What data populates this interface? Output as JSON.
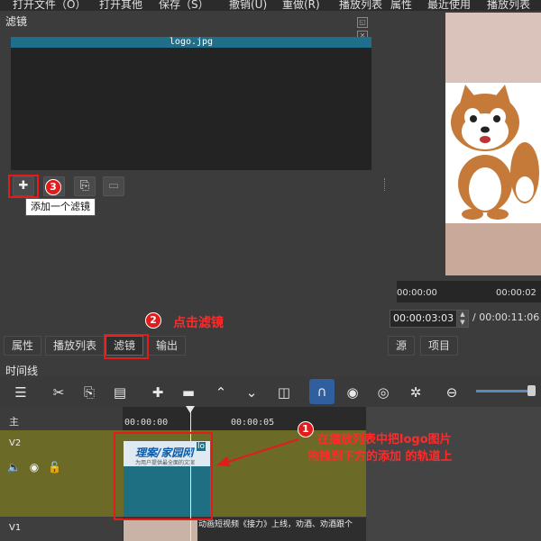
{
  "menu": {
    "items": [
      "打开文件（O）",
      "打开其他",
      "保存（S）",
      "撤销(U)",
      "重做(R)",
      "播放列表",
      "属性",
      "最近使用",
      "播放列表"
    ]
  },
  "filter_panel": {
    "title": "滤镜",
    "list_header": "logo.jpg",
    "tooltip": "添加一个滤镜"
  },
  "preview": {
    "ruler_left": "00:00:00",
    "ruler_right": "00:00:02",
    "timecode": "00:00:03:03",
    "duration": "/ 00:00:11:06"
  },
  "tabs": {
    "left": [
      "属性",
      "播放列表",
      "滤镜",
      "输出"
    ],
    "right": [
      "源",
      "项目"
    ],
    "selected": "滤镜"
  },
  "timeline": {
    "title": "时间线",
    "master_label": "主",
    "ruler_ticks": [
      "00:00:00",
      "00:00:05"
    ],
    "v2_label": "V2",
    "v1_label": "V1",
    "clip_name_short": "lo",
    "clip_logo_text": "理案/家园网",
    "clip_logo_sub": "为用户提供最全面的文案",
    "v1_clip_text": "动画短视频《接力》上线，劝酒、劝酒跟个"
  },
  "annotations": {
    "step1_number": "1",
    "step1_text_line1": "在播放列表中把logo图片",
    "step1_text_line2": "拖拽到下方的添加 的轨道上",
    "step2_number": "2",
    "step2_text": "点击滤镜",
    "step3_number": "3"
  },
  "colors": {
    "annotation_red": "#e21b1b",
    "list_header": "#1f6f8b",
    "track_v2": "#6b6b27"
  }
}
